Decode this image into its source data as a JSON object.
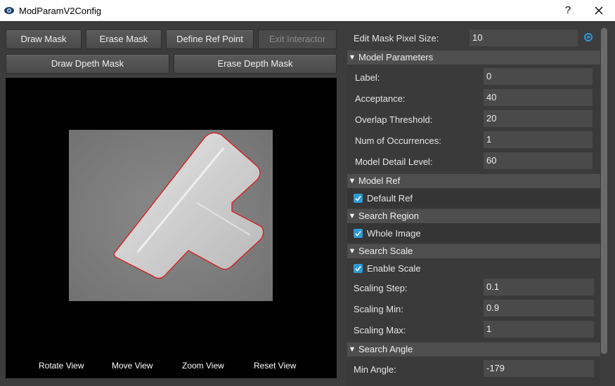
{
  "window": {
    "title": "ModParamV2Config",
    "help_label": "?"
  },
  "toolbar": {
    "draw_mask": "Draw Mask",
    "erase_mask": "Erase Mask",
    "define_ref_point": "Define Ref Point",
    "exit_interactor": "Exit Interactor",
    "draw_depth_mask": "Draw Dpeth Mask",
    "erase_depth_mask": "Erase Depth Mask"
  },
  "viewer": {
    "tools": [
      "Rotate View",
      "Move View",
      "Zoom View",
      "Reset View"
    ]
  },
  "edit_mask": {
    "label": "Edit Mask Pixel Size:",
    "value": "10"
  },
  "model_parameters": {
    "header": "Model Parameters",
    "fields": [
      {
        "label": "Label:",
        "value": "0"
      },
      {
        "label": "Acceptance:",
        "value": "40"
      },
      {
        "label": "Overlap Threshold:",
        "value": "20"
      },
      {
        "label": "Num of Occurrences:",
        "value": "1"
      },
      {
        "label": "Model Detail Level:",
        "value": "60"
      }
    ]
  },
  "model_ref": {
    "header": "Model Ref",
    "checkbox": "Default Ref",
    "checked": true
  },
  "search_region": {
    "header": "Search Region",
    "checkbox": "Whole Image",
    "checked": true
  },
  "search_scale": {
    "header": "Search Scale",
    "checkbox": "Enable Scale",
    "checked": true,
    "fields": [
      {
        "label": "Scaling Step:",
        "value": "0.1"
      },
      {
        "label": "Scaling Min:",
        "value": "0.9"
      },
      {
        "label": "Scaling Max:",
        "value": "1"
      }
    ]
  },
  "search_angle": {
    "header": "Search Angle",
    "fields": [
      {
        "label": "Min Angle:",
        "value": "-179"
      }
    ]
  },
  "colors": {
    "accent": "#2d9ad7",
    "mask_outline": "#e01010"
  },
  "icons": {
    "collapse": "triangle-down-icon",
    "check": "check-icon"
  }
}
